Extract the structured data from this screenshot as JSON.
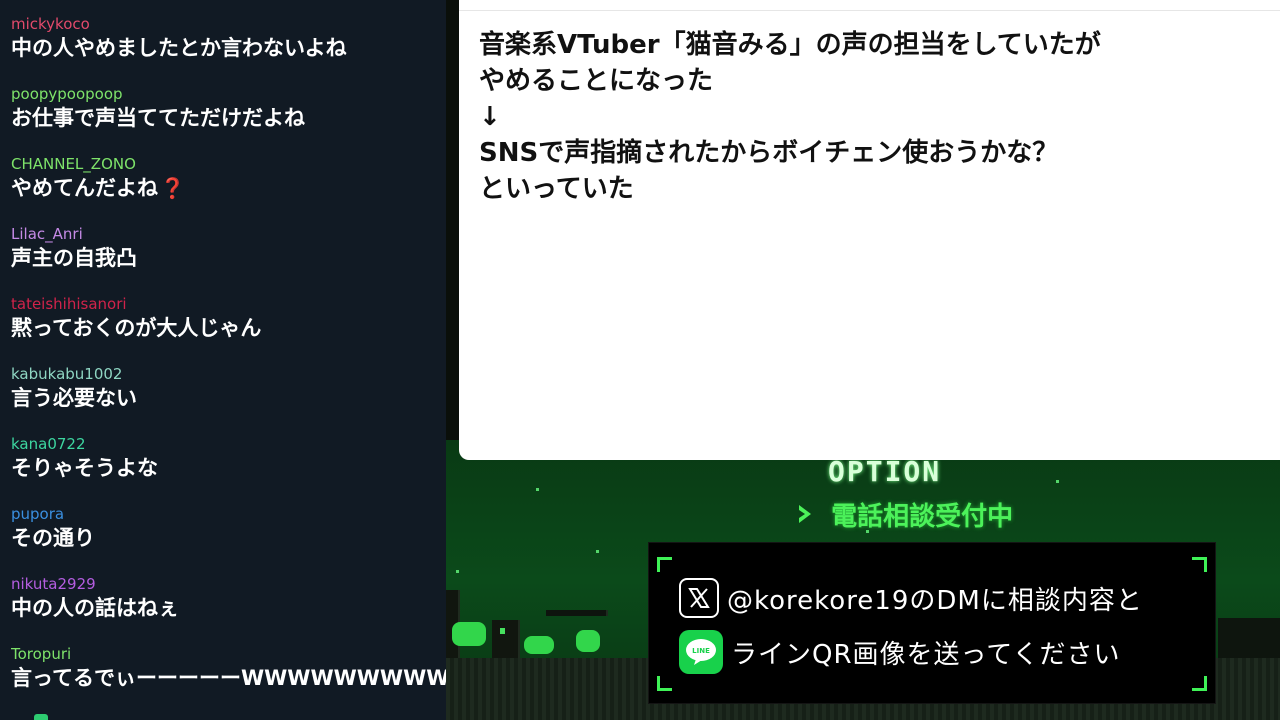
{
  "chat": {
    "messages": [
      {
        "user": "mickykoco",
        "text": "中の人やめましたとか言わないよね",
        "color": "#e24a6b"
      },
      {
        "user": "poopypoopoop",
        "text": "お仕事で声当ててただけだよね",
        "color": "#7ee36a"
      },
      {
        "user": "CHANNEL_ZONO",
        "text": "やめてんだよね",
        "color": "#7ee36a",
        "emoji": "❓"
      },
      {
        "user": "Lilac_Anri",
        "text": "声主の自我凸",
        "color": "#c58ae6"
      },
      {
        "user": "tateishihisanori",
        "text": "黙っておくのが大人じゃん",
        "color": "#d0234a"
      },
      {
        "user": "kabukabu1002",
        "text": "言う必要ない",
        "color": "#8fd6c3"
      },
      {
        "user": "kana0722",
        "text": "そりゃそうよな",
        "color": "#3dd6a0"
      },
      {
        "user": "pupora",
        "text": "その通り",
        "color": "#3a8fe0"
      },
      {
        "user": "nikuta2929",
        "text": "中の人の話はねぇ",
        "color": "#b45de0"
      },
      {
        "user": "Toropuri",
        "text": "言ってるでぃーーーーーWWWWWWWWW",
        "color": "#7ee36a"
      }
    ]
  },
  "panel": {
    "text": "音楽系VTuber「猫音みる」の声の担当をしていたが\nやめることになった\n↓\nSNSで声指摘されたからボイチェン使おうかな？\nといっていた"
  },
  "stream": {
    "option_title": "OPTION",
    "consult_label": "電話相談受付中",
    "info": {
      "dm_text": "@korekore19のDMに相談内容と",
      "line_text": "ラインQR画像を送ってください",
      "line_icon_label": "LINE"
    }
  },
  "icons": {
    "x": "x-logo-icon",
    "line": "line-app-icon",
    "consult_arrow": "chevron-right-icon",
    "question": "question-mark-emoji-icon"
  },
  "colors": {
    "chat_bg": "#111a24",
    "accent_green": "#3ff257",
    "line_green": "#18d14b"
  }
}
